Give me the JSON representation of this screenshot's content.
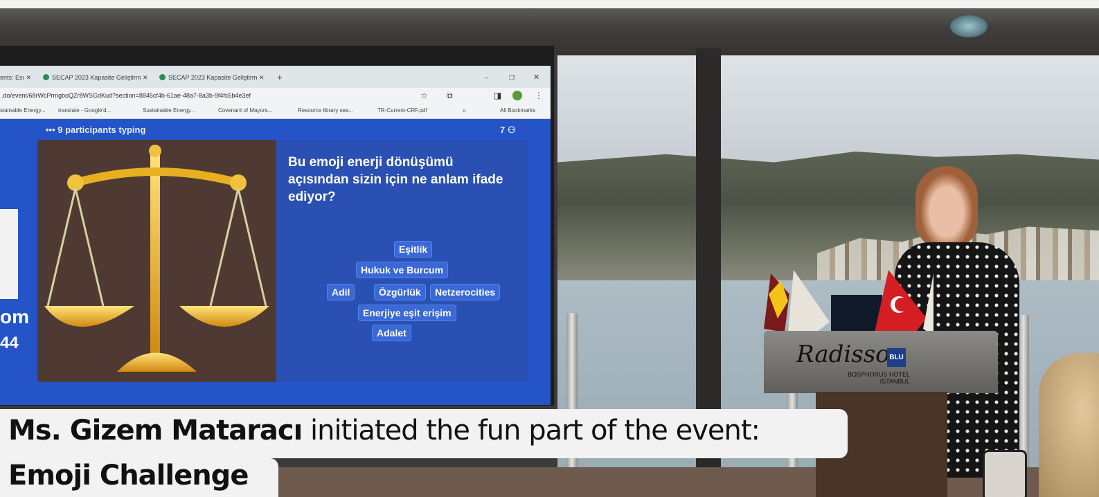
{
  "browser": {
    "tabs": [
      "ents: Esı",
      "SECAP 2023 Kapasite Geliştirm",
      "SECAP 2023 Kapasite Geliştirm"
    ],
    "address": ".do/event/68rWcPrmgboQZr8WSGdKud?section=8845cf4b-61ae-48a7-8a3b-9f4fc5b4e3ef",
    "bookmarks": [
      "stainable Energy...",
      "translate - Google'd...",
      "Sustainable Energy...",
      "Covenant of Mayors...",
      "Resource library sea...",
      "TR-Current-CRF.pdf",
      "»",
      "All Bookmarks"
    ]
  },
  "presentation": {
    "typing_status": "••• 9 participants typing",
    "participant_count": "7",
    "question": "Bu emoji enerji dönüşümü açısından sizin için ne anlam ifade ediyor?",
    "answers": [
      "Eşitlik",
      "Hukuk ve Burcum",
      "Adil",
      "Özgürlük",
      "Netzerocities",
      "Enerjiye eşit erişim",
      "Adalet"
    ],
    "side_text": [
      "om",
      "44"
    ]
  },
  "podium": {
    "brand": "Radisson",
    "brand_badge": "BLU",
    "hotel_line1": "BOSPHORUS HOTEL",
    "hotel_line2": "ISTANBUL"
  },
  "caption": {
    "name": "Ms. Gizem Mataracı",
    "rest": " initiated the fun part of the event:",
    "line2": "Emoji Challenge"
  },
  "colors": {
    "slide_blue": "#2454c8",
    "scale_gold": "#e8b020",
    "caption_bg": "#f2f2f2"
  }
}
